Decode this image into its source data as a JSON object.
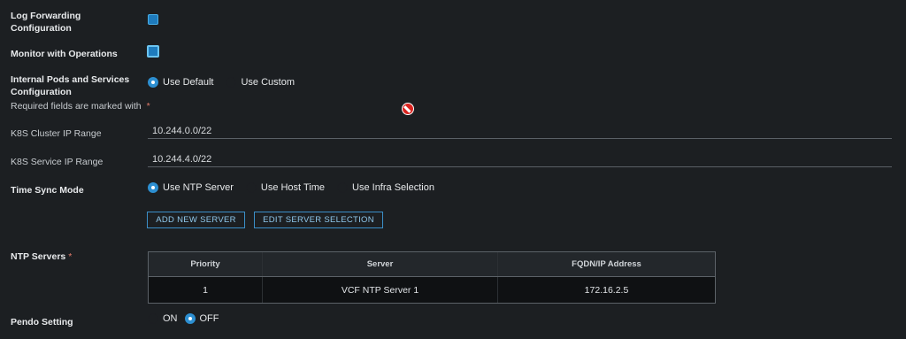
{
  "log_forwarding": {
    "label_line1": "Log Forwarding",
    "label_line2": "Configuration",
    "checked": true
  },
  "monitor_ops": {
    "label": "Monitor with Operations",
    "checked": true
  },
  "internal_pods": {
    "label_line1": "Internal Pods and Services",
    "label_line2": "Configuration",
    "options": [
      "Use Default",
      "Use Custom"
    ],
    "selected": "Use Default"
  },
  "required_hint": {
    "text": "Required fields are marked with",
    "mark": "*"
  },
  "k8s_cluster": {
    "label": "K8S Cluster IP Range",
    "value": "10.244.0.0/22"
  },
  "k8s_service": {
    "label": "K8S Service IP Range",
    "value": "10.244.4.0/22"
  },
  "time_sync": {
    "label": "Time Sync Mode",
    "options": [
      "Use NTP Server",
      "Use Host Time",
      "Use Infra Selection"
    ],
    "selected": "Use NTP Server"
  },
  "buttons": {
    "add": "ADD NEW SERVER",
    "edit": "EDIT SERVER SELECTION"
  },
  "ntp_servers": {
    "label": "NTP Servers",
    "mark": "*",
    "columns": [
      "Priority",
      "Server",
      "FQDN/IP Address"
    ],
    "rows": [
      {
        "priority": "1",
        "server": "VCF NTP Server 1",
        "address": "172.16.2.5"
      }
    ]
  },
  "pendo": {
    "label": "Pendo Setting",
    "options": [
      "ON",
      "OFF"
    ],
    "selected": "OFF"
  },
  "colors": {
    "accent": "#2d8fd1",
    "background": "#1c1f22",
    "required": "#e07a6a",
    "error": "#d9231f"
  },
  "icons": {
    "required_indicator": "no-entry-icon"
  }
}
